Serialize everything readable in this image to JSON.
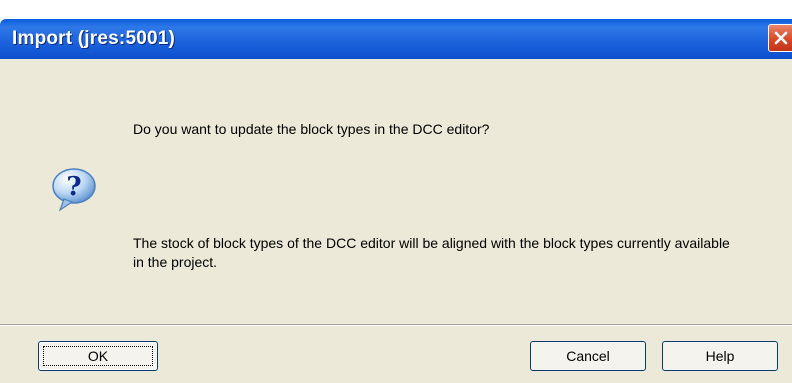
{
  "window": {
    "title": "Import (jres:5001)"
  },
  "icons": {
    "dialog_icon": "question-icon",
    "close_icon": "close-icon"
  },
  "message": {
    "question": "Do you want to update the block types in the DCC editor?",
    "detail": "The stock of block types of the DCC editor will be aligned with the block types currently available in the project."
  },
  "buttons": {
    "ok_label": "OK",
    "cancel_label": "Cancel",
    "help_label": "Help"
  },
  "colors": {
    "titlebar": "#0a5ddf",
    "dialog_background": "#ece9d8",
    "close_button": "#d8492a"
  }
}
